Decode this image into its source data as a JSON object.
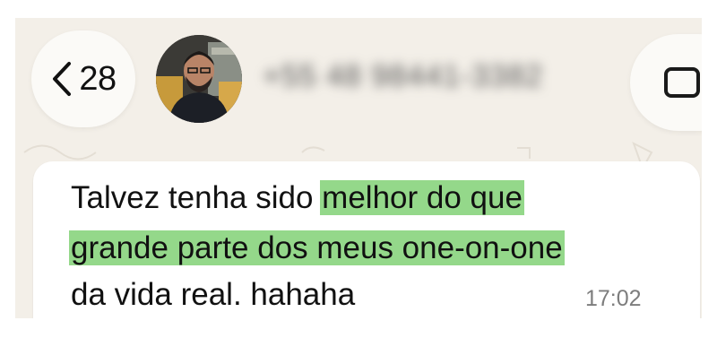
{
  "header": {
    "back_count": "28",
    "contact_name": "+55 48 98441-3382"
  },
  "message": {
    "line1_plain": "Talvez tenha sido ",
    "line1_highlight": "melhor do que",
    "line2_highlight": "grande parte dos meus one-on-one",
    "line3_plain": "da vida real.  hahaha",
    "timestamp": "17:02"
  },
  "colors": {
    "highlight": "#94d88a",
    "chat_background": "#f3efe8",
    "bubble": "#ffffff"
  },
  "icons": {
    "back": "chevron-left-icon",
    "video": "video-camera-icon"
  }
}
